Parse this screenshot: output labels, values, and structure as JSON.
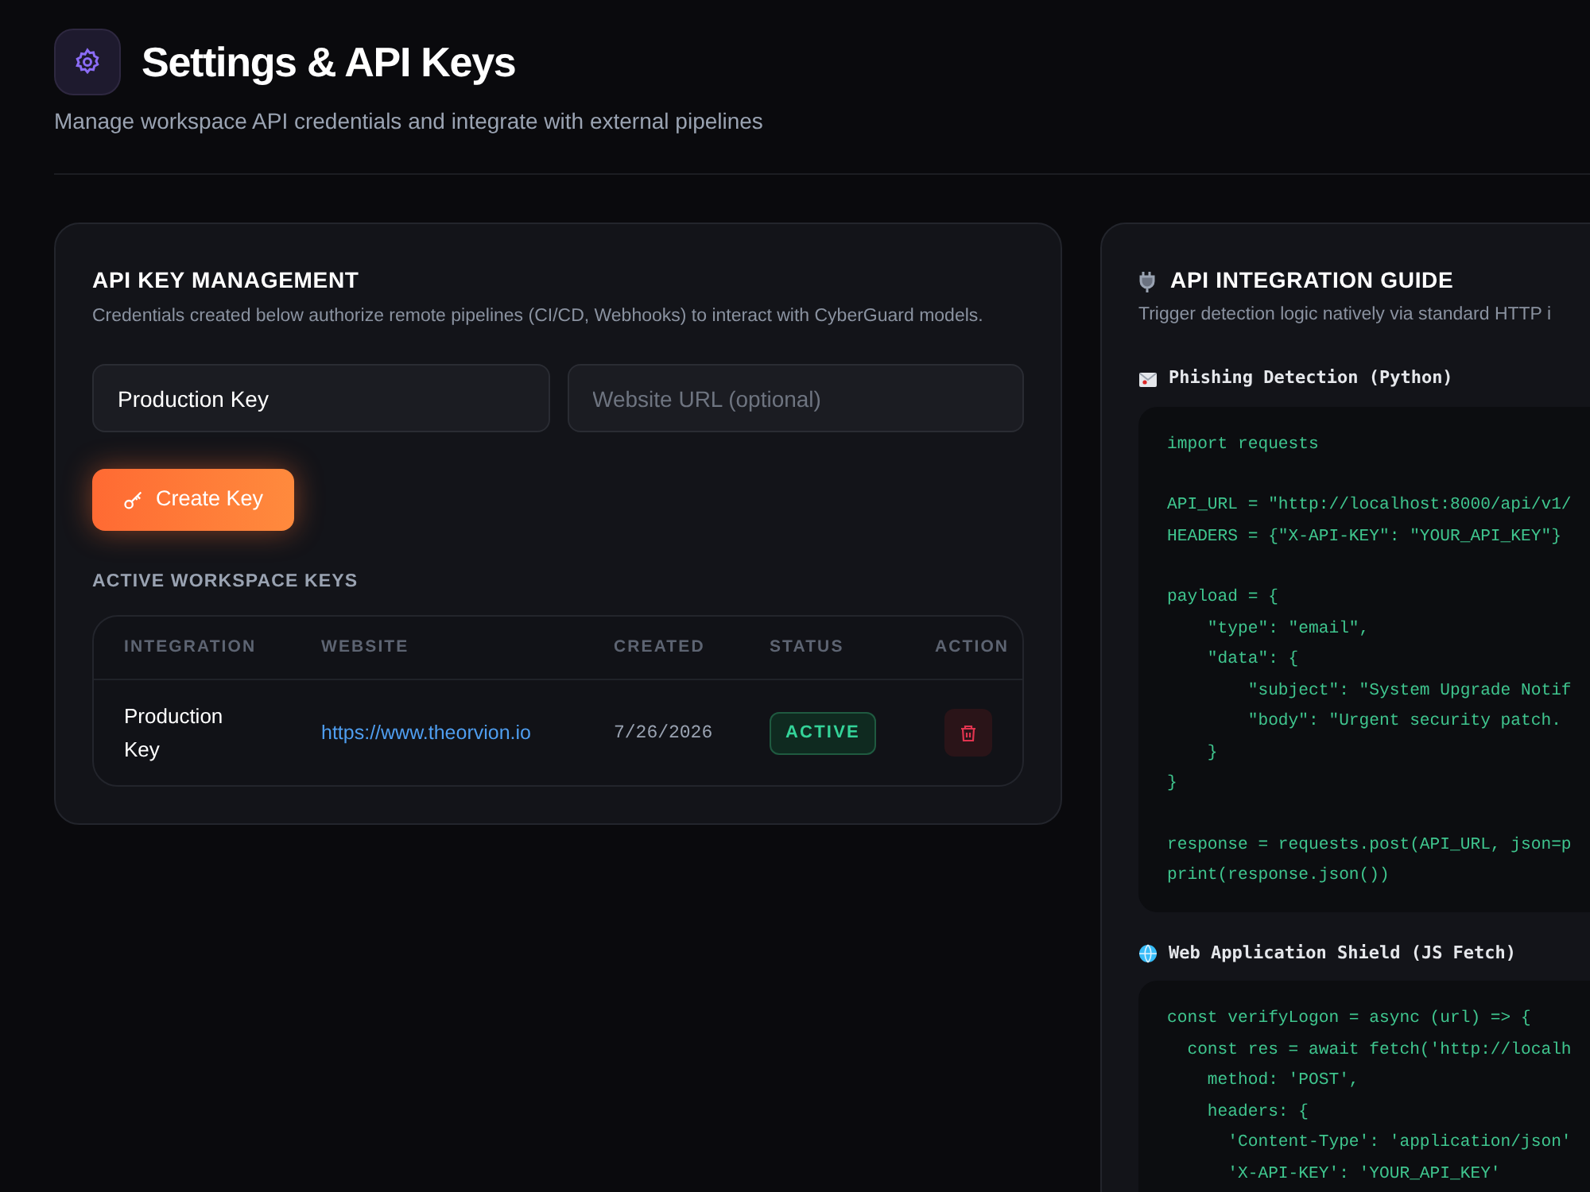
{
  "header": {
    "title": "Settings & API Keys",
    "subtitle": "Manage workspace API credentials and integrate with external pipelines"
  },
  "key_management": {
    "title": "API KEY MANAGEMENT",
    "description": "Credentials created below authorize remote pipelines (CI/CD, Webhooks) to interact with CyberGuard models.",
    "name_field": {
      "value": "Production Key"
    },
    "url_field": {
      "placeholder": "Website URL (optional)"
    },
    "create_button": "Create Key",
    "keys_heading": "ACTIVE WORKSPACE KEYS",
    "table": {
      "columns": [
        "INTEGRATION",
        "WEBSITE",
        "CREATED",
        "STATUS",
        "ACTION"
      ],
      "rows": [
        {
          "integration": "Production Key",
          "website": "https://www.theorvion.io",
          "created": "7/26/2026",
          "status": "ACTIVE"
        }
      ]
    }
  },
  "integration_guide": {
    "title": "API INTEGRATION GUIDE",
    "description": "Trigger detection logic natively via standard HTTP i",
    "snippets": [
      {
        "kind": "email",
        "title": "Phishing Detection (Python)",
        "blocks": [
          [
            "import requests"
          ],
          [
            "API_URL = \"http://localhost:8000/api/v1/",
            "HEADERS = {\"X-API-KEY\": \"YOUR_API_KEY\"}"
          ],
          [
            "payload = {",
            "    \"type\": \"email\",",
            "    \"data\": {",
            "        \"subject\": \"System Upgrade Notif",
            "        \"body\": \"Urgent security patch.",
            "    }",
            "}"
          ],
          [
            "response = requests.post(API_URL, json=p",
            "print(response.json())"
          ]
        ]
      },
      {
        "kind": "web",
        "title": "Web Application Shield (JS Fetch)",
        "blocks": [
          [
            "const verifyLogon = async (url) => {",
            "  const res = await fetch('http://localh",
            "    method: 'POST',",
            "    headers: {",
            "      'Content-Type': 'application/json'",
            "      'X-API-KEY': 'YOUR_API_KEY'"
          ]
        ]
      }
    ]
  }
}
